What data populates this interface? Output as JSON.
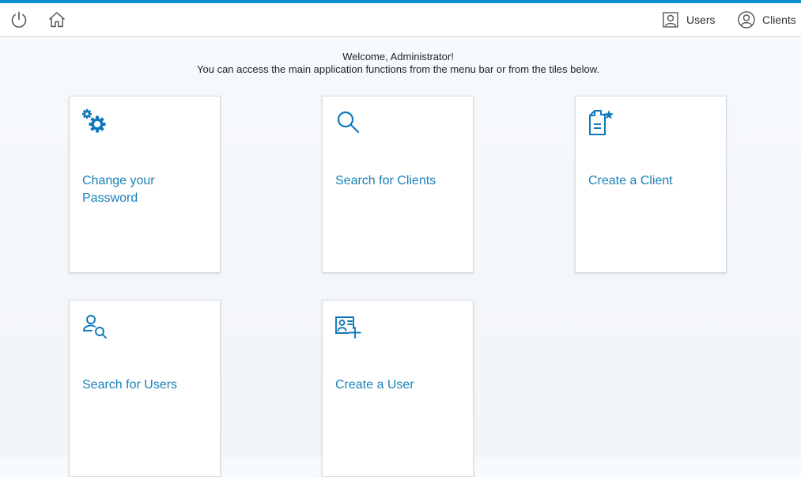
{
  "theme": {
    "accent": "#0a8ed6",
    "tile_text": "#1a82b9",
    "icon_color": "#1078b8"
  },
  "topbar": {
    "power_icon": "power-icon",
    "home_icon": "home-icon",
    "users_label": "Users",
    "clients_label": "Clients"
  },
  "welcome": {
    "line1": "Welcome, Administrator!",
    "line2": "You can access the main application functions from the menu bar or from the tiles below."
  },
  "tiles": [
    {
      "label": "Change your Password",
      "icon": "gears-icon"
    },
    {
      "label": "Search for Clients",
      "icon": "search-icon"
    },
    {
      "label": "Create a Client",
      "icon": "new-document-icon"
    },
    {
      "label": "Search for Users",
      "icon": "user-search-icon"
    },
    {
      "label": "Create a User",
      "icon": "add-user-card-icon"
    }
  ]
}
